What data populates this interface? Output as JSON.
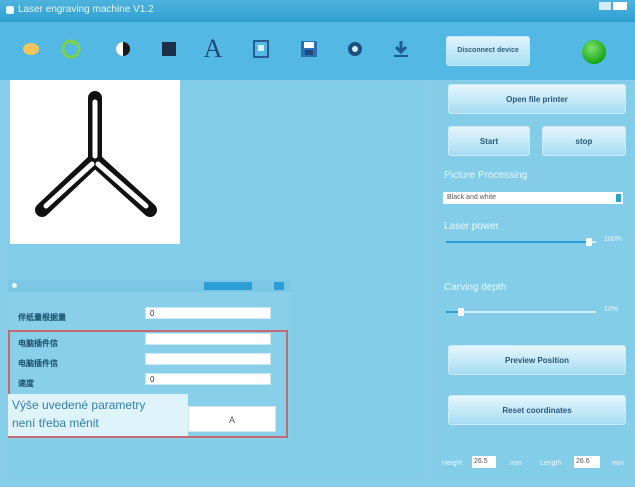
{
  "window": {
    "title": "Laser engraving machine V1.2"
  },
  "toolbar": {
    "items": [
      {
        "name": "open-icon",
        "label": "Open"
      },
      {
        "name": "refresh-icon",
        "label": "Refresh"
      },
      {
        "name": "contrast-icon",
        "label": "Invert"
      },
      {
        "name": "square-icon",
        "label": "Image"
      },
      {
        "name": "text-icon",
        "label": "A"
      },
      {
        "name": "frame-icon",
        "label": "Frame"
      },
      {
        "name": "save-icon",
        "label": "Save"
      },
      {
        "name": "settings-icon",
        "label": "Settings"
      },
      {
        "name": "download-icon",
        "label": "Download"
      }
    ],
    "connect_label": "Disconnect device"
  },
  "right_panel": {
    "open_file_label": "Open file printer",
    "start_label": "Start",
    "stop_label": "stop",
    "processing_label": "Picture Processing",
    "processing_value": "Black and white",
    "laser_power_label": "Laser power",
    "laser_power_value": "100%",
    "laser_power_fraction": 0.95,
    "carving_depth_label": "Carving depth",
    "carving_depth_value": "10%",
    "carving_depth_fraction": 0.1,
    "preview_label": "Preview Position",
    "reset_label": "Reset coordinates",
    "stat1_label": "Height",
    "stat1_value": "26.5",
    "stat2_label": "mm",
    "stat3_label": "Length",
    "stat3_value": "26.6",
    "stat4_label": "mm"
  },
  "params": {
    "rows": [
      {
        "label": "伴纸量根据量",
        "value": "0"
      },
      {
        "label": "电脑插件信",
        "value": ""
      },
      {
        "label": "电脑插件信",
        "value": ""
      },
      {
        "label": "速度",
        "value": "0"
      }
    ],
    "bottom_value": "A"
  },
  "note": {
    "line1": "Výše uvedené parametry",
    "line2": "není třeba měnit"
  }
}
